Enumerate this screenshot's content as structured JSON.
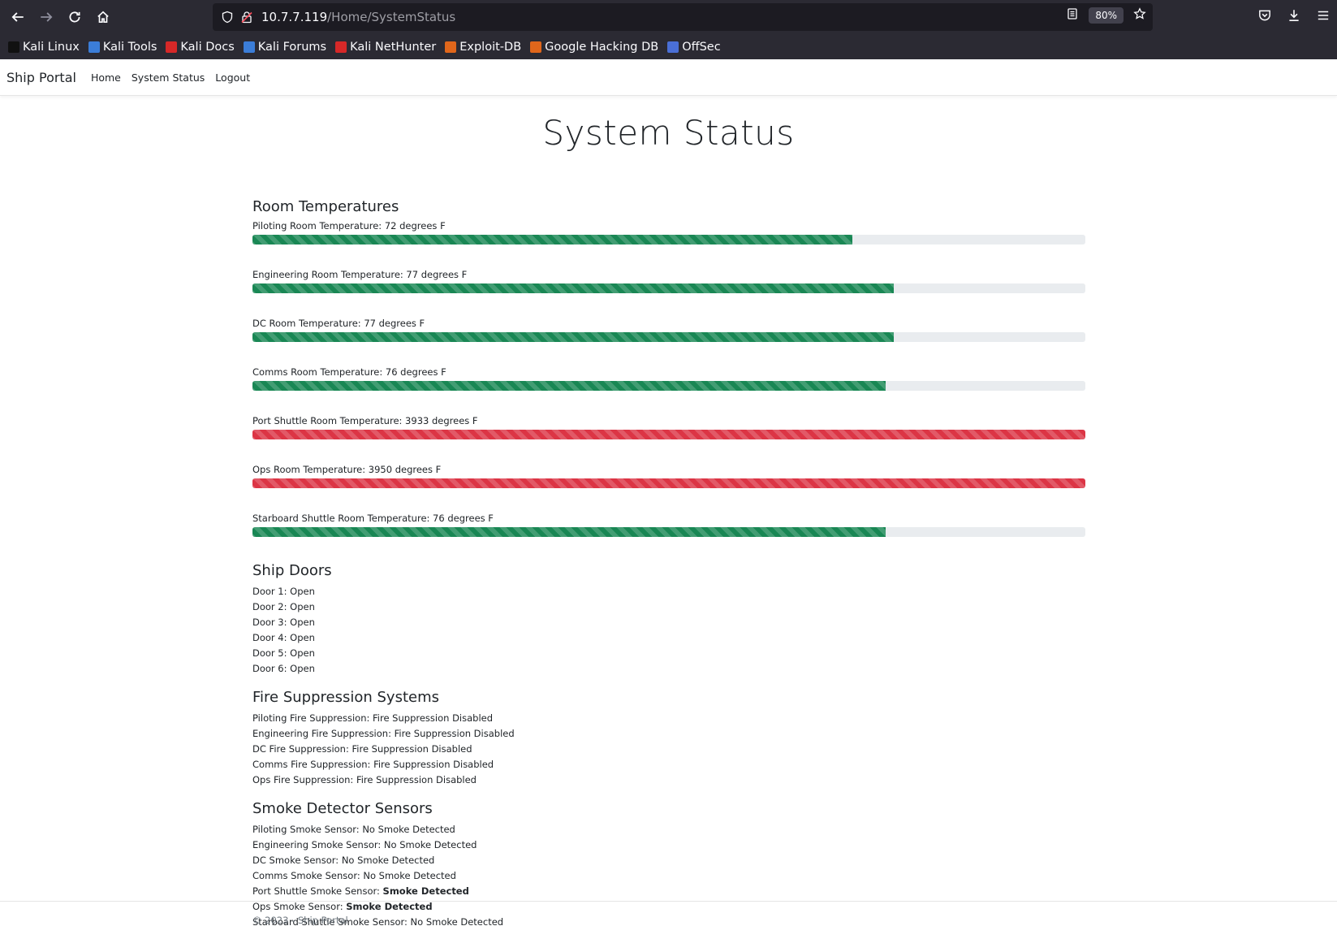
{
  "browser": {
    "url_host": "10.7.7.119",
    "url_path": "/Home/SystemStatus",
    "zoom": "80%",
    "bookmarks": [
      {
        "label": "Kali Linux",
        "icon": "kali-dragon-icon",
        "color": "#111111"
      },
      {
        "label": "Kali Tools",
        "icon": "kali-tools-icon",
        "color": "#3b7dd8"
      },
      {
        "label": "Kali Docs",
        "icon": "kali-docs-icon",
        "color": "#d62828"
      },
      {
        "label": "Kali Forums",
        "icon": "kali-forums-icon",
        "color": "#3b7dd8"
      },
      {
        "label": "Kali NetHunter",
        "icon": "kali-nethunter-icon",
        "color": "#d62828"
      },
      {
        "label": "Exploit-DB",
        "icon": "exploit-db-icon",
        "color": "#e0661b"
      },
      {
        "label": "Google Hacking DB",
        "icon": "ghdb-icon",
        "color": "#e0661b"
      },
      {
        "label": "OffSec",
        "icon": "offsec-icon",
        "color": "#4a6fd6"
      }
    ]
  },
  "nav": {
    "brand": "Ship Portal",
    "links": [
      "Home",
      "System Status",
      "Logout"
    ]
  },
  "page": {
    "title": "System Status"
  },
  "temperatures": {
    "title": "Room Temperatures",
    "items": [
      {
        "label": "Piloting Room Temperature: 72 degrees F",
        "fill_percent": 72,
        "status": "ok"
      },
      {
        "label": "Engineering Room Temperature: 77 degrees F",
        "fill_percent": 77,
        "status": "ok"
      },
      {
        "label": "DC Room Temperature: 77 degrees F",
        "fill_percent": 77,
        "status": "ok"
      },
      {
        "label": "Comms Room Temperature: 76 degrees F",
        "fill_percent": 76,
        "status": "ok"
      },
      {
        "label": "Port Shuttle Room Temperature: 3933 degrees F",
        "fill_percent": 100,
        "status": "bad"
      },
      {
        "label": "Ops Room Temperature: 3950 degrees F",
        "fill_percent": 100,
        "status": "bad"
      },
      {
        "label": "Starboard Shuttle Room Temperature: 76 degrees F",
        "fill_percent": 76,
        "status": "ok"
      }
    ]
  },
  "doors": {
    "title": "Ship Doors",
    "items": [
      "Door 1: Open",
      "Door 2: Open",
      "Door 3: Open",
      "Door 4: Open",
      "Door 5: Open",
      "Door 6: Open"
    ]
  },
  "fire": {
    "title": "Fire Suppression Systems",
    "items": [
      "Piloting Fire Suppression: Fire Suppression Disabled",
      "Engineering Fire Suppression: Fire Suppression Disabled",
      "DC Fire Suppression: Fire Suppression Disabled",
      "Comms Fire Suppression: Fire Suppression Disabled",
      "Ops Fire Suppression: Fire Suppression Disabled"
    ]
  },
  "smoke": {
    "title": "Smoke Detector Sensors",
    "items": [
      {
        "label": "Piloting Smoke Sensor: ",
        "value": "No Smoke Detected",
        "alert": false
      },
      {
        "label": "Engineering Smoke Sensor: ",
        "value": "No Smoke Detected",
        "alert": false
      },
      {
        "label": "DC Smoke Sensor: ",
        "value": "No Smoke Detected",
        "alert": false
      },
      {
        "label": "Comms Smoke Sensor: ",
        "value": "No Smoke Detected",
        "alert": false
      },
      {
        "label": "Port Shuttle Smoke Sensor: ",
        "value": "Smoke Detected",
        "alert": true
      },
      {
        "label": "Ops Smoke Sensor: ",
        "value": "Smoke Detected",
        "alert": true
      },
      {
        "label": "Starboard Shuttle Smoke Sensor: ",
        "value": "No Smoke Detected",
        "alert": false
      }
    ]
  },
  "footer": {
    "text": "© 2023 - Ship Portal"
  }
}
